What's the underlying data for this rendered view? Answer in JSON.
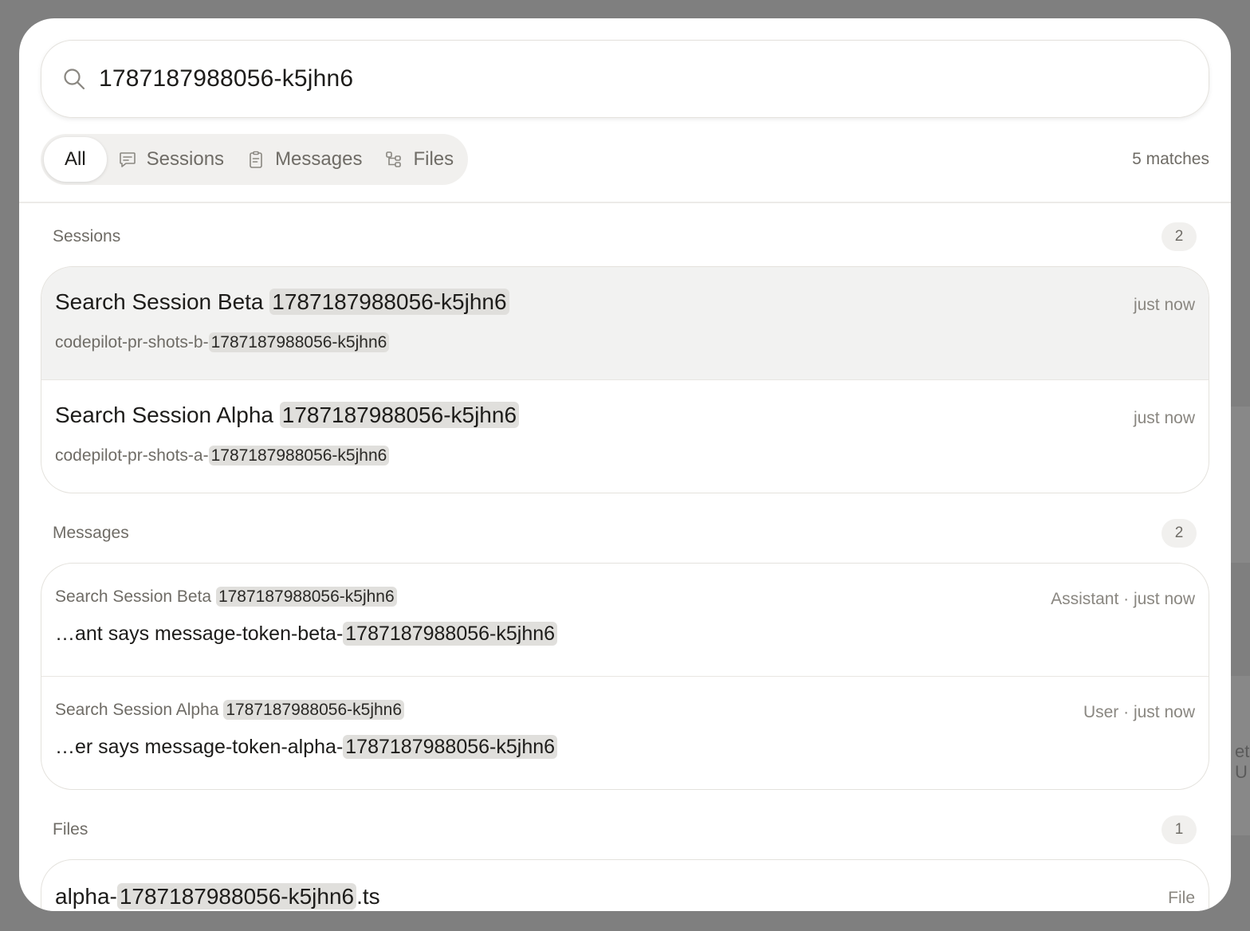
{
  "search": {
    "query": "1787187988056-k5jhn6"
  },
  "filters": {
    "tabs": [
      {
        "label": "All",
        "icon": "none",
        "active": true
      },
      {
        "label": "Sessions",
        "icon": "chat-bubble-icon",
        "active": false
      },
      {
        "label": "Messages",
        "icon": "clipboard-icon",
        "active": false
      },
      {
        "label": "Files",
        "icon": "file-tree-icon",
        "active": false
      }
    ],
    "match_count": "5 matches"
  },
  "sections": {
    "sessions": {
      "title": "Sessions",
      "count": "2",
      "items": [
        {
          "title": "Search Session Beta ",
          "title_hl": "1787187988056-k5jhn6",
          "sub": "codepilot-pr-shots-b-",
          "sub_hl": "1787187988056-k5jhn6",
          "time": "just now"
        },
        {
          "title": "Search Session Alpha ",
          "title_hl": "1787187988056-k5jhn6",
          "sub": "codepilot-pr-shots-a-",
          "sub_hl": "1787187988056-k5jhn6",
          "time": "just now"
        }
      ]
    },
    "messages": {
      "title": "Messages",
      "count": "2",
      "items": [
        {
          "session": "Search Session Beta ",
          "session_hl": "1787187988056-k5jhn6",
          "meta": "Assistant · just now",
          "body": "…ant says message-token-beta-",
          "body_hl": "1787187988056-k5jhn6"
        },
        {
          "session": "Search Session Alpha ",
          "session_hl": "1787187988056-k5jhn6",
          "meta": "User · just now",
          "body": "…er says message-token-alpha-",
          "body_hl": "1787187988056-k5jhn6"
        }
      ]
    },
    "files": {
      "title": "Files",
      "count": "1",
      "items": [
        {
          "prefix": "alpha-",
          "hl": "1787187988056-k5jhn6",
          "suffix": ".ts",
          "kind": "File"
        }
      ]
    }
  },
  "background": {
    "ghost_text": "et U"
  }
}
